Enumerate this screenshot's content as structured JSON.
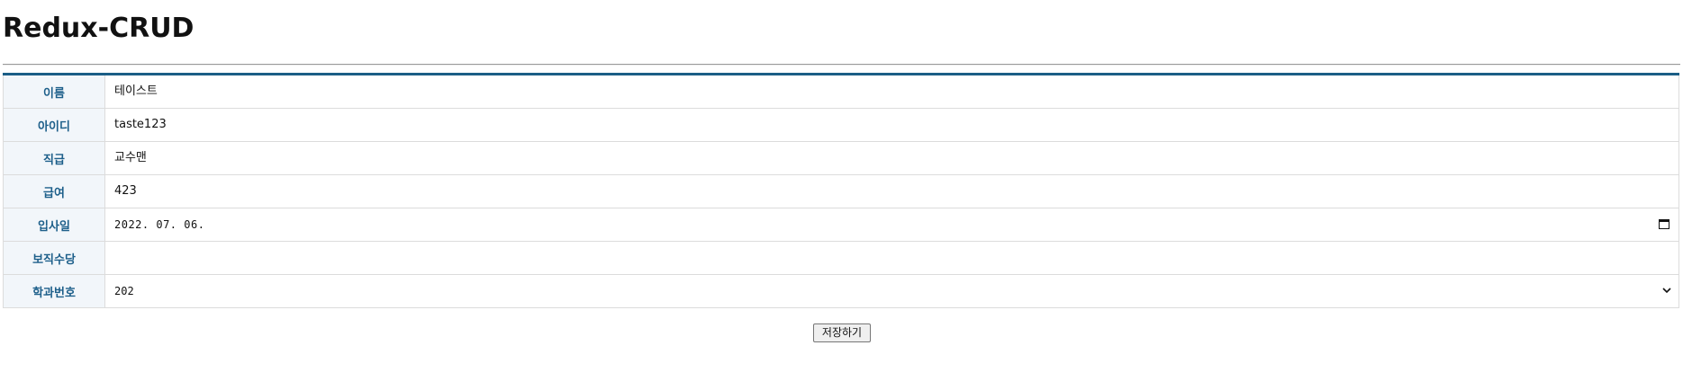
{
  "page": {
    "title": "Redux-CRUD"
  },
  "form": {
    "rows": [
      {
        "label": "이름",
        "value": "테이스트"
      },
      {
        "label": "아이디",
        "value": "taste123"
      },
      {
        "label": "직급",
        "value": "교수맨"
      },
      {
        "label": "급여",
        "value": "423"
      },
      {
        "label": "입사일",
        "value": "2022. 07. 06."
      },
      {
        "label": "보직수당",
        "value": ""
      },
      {
        "label": "학과번호",
        "value": "202"
      }
    ]
  },
  "actions": {
    "save_label": "저장하기"
  },
  "icons": {
    "date": "calendar-icon",
    "select": "chevron-down-icon"
  }
}
